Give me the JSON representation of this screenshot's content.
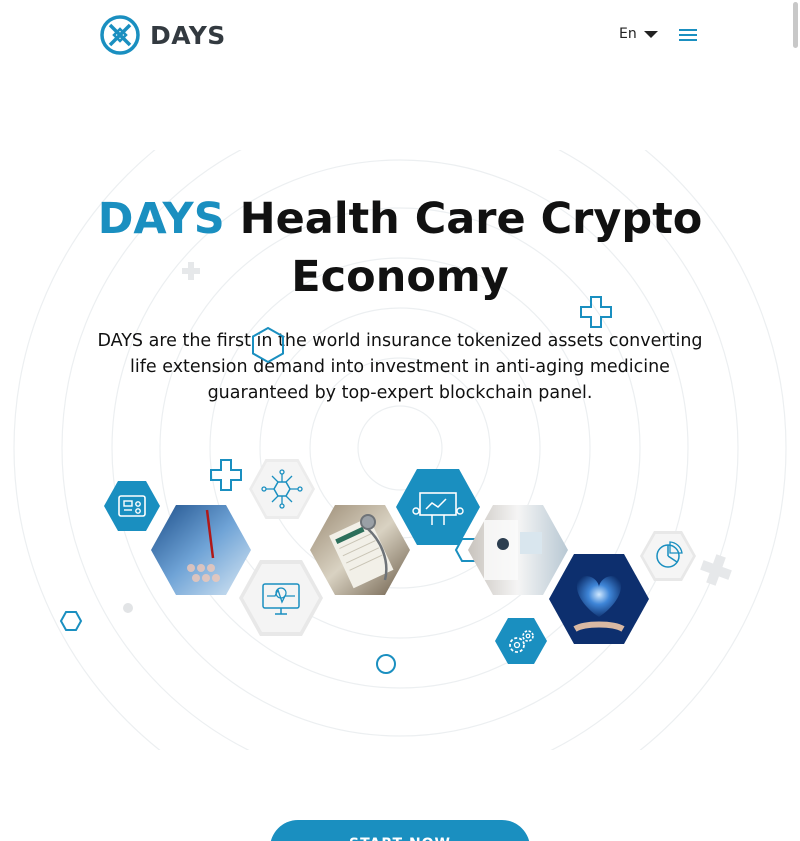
{
  "header": {
    "logo_text": "DAYS",
    "language": "En"
  },
  "hero": {
    "title_brand": "DAYS",
    "title_rest": "Health Care Crypto Economy",
    "subtitle": "DAYS are the first in the world insurance tokenized assets converting life extension demand into investment in anti-aging medicine guaranteed by top-expert blockchain panel."
  },
  "cta": {
    "label": "START NOW"
  },
  "colors": {
    "brand": "#1a8fc0",
    "text": "#111111",
    "logo_text": "#333a40",
    "hex_light": "#eeeeee"
  },
  "icons": [
    "logo-icon",
    "chevron-down-icon",
    "menu-icon",
    "cross-outline-icon",
    "hexagon-outline-icon",
    "circle-outline-icon",
    "medical-device-icon",
    "network-icon",
    "presentation-icon",
    "monitor-heartbeat-icon",
    "pie-chart-icon",
    "gears-icon",
    "laboratory-photo",
    "document-stethoscope-photo",
    "doctor-photo",
    "heart-hands-photo"
  ]
}
